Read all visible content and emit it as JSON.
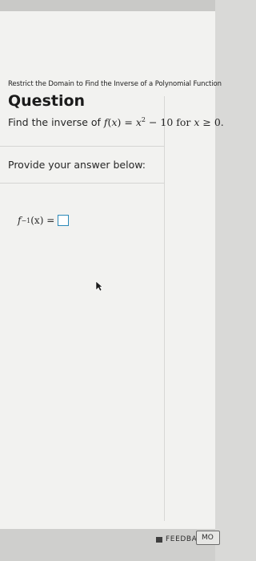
{
  "breadcrumb": "Restrict the Domain to Find the Inverse of a Polynomial Function",
  "heading": "Question",
  "question": {
    "prefix": "Find the inverse of ",
    "f": "f",
    "open": "(",
    "x": "x",
    "close_eq": ") = ",
    "x2": "x",
    "exp": "2",
    "rest": " − 10 for ",
    "x3": "x",
    "cond": " ≥ 0."
  },
  "provide": "Provide your answer below:",
  "answer": {
    "f": "f",
    "inv": "−1",
    "arg": "(x) = "
  },
  "footer": {
    "feedback_label": "FEEDBACK",
    "more_label": "MO"
  }
}
